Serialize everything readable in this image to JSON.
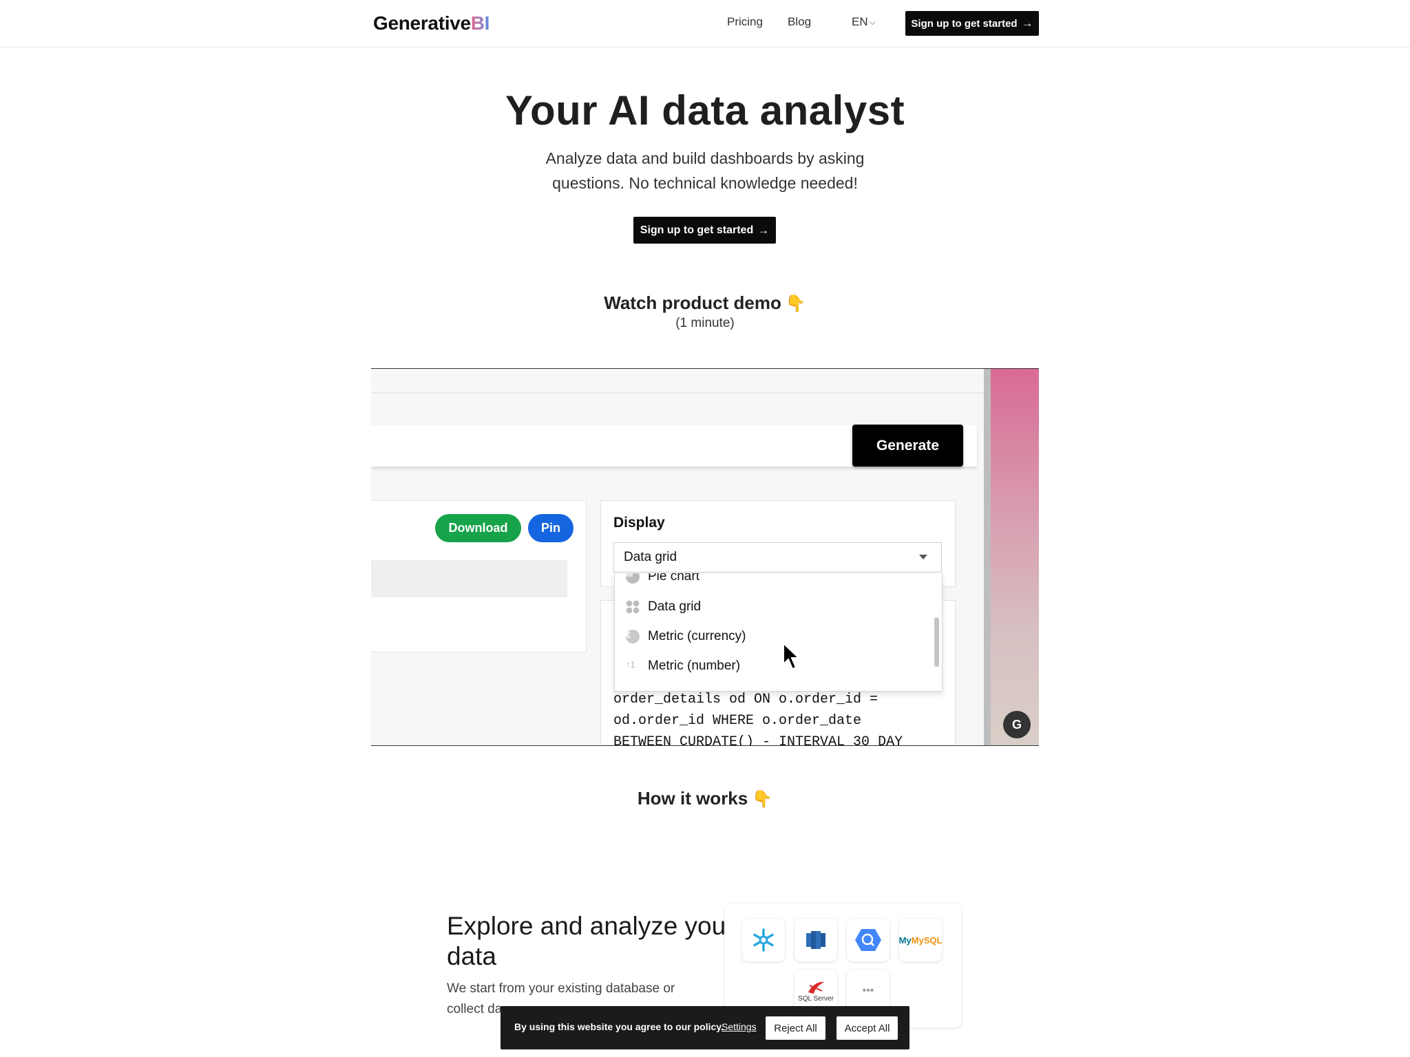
{
  "header": {
    "logo_main": "Generative",
    "logo_accent": "BI",
    "nav": [
      {
        "label": "Pricing"
      },
      {
        "label": "Blog"
      }
    ],
    "language": "EN",
    "cta_label": "Sign up to get started"
  },
  "hero": {
    "title": "Your AI data analyst",
    "subtitle": "Analyze data and build dashboards by asking questions. No technical knowledge needed!",
    "cta_label": "Sign up to get started"
  },
  "demo": {
    "title": "Watch product demo",
    "duration": "(1 minute)",
    "video": {
      "generate_label": "Generate",
      "download_label": "Download",
      "pin_label": "Pin",
      "display_label": "Display",
      "display_value": "Data grid",
      "options": [
        "Pie chart",
        "Data grid",
        "Metric (currency)",
        "Metric (number)"
      ],
      "sql_lines": [
        "order_details od ON o.order_id =",
        "od.order_id WHERE o.order_date",
        "BETWEEN CURDATE() - INTERVAL 30 DAY"
      ],
      "badge": "G"
    }
  },
  "how_it_works": {
    "title": "How it works"
  },
  "explore": {
    "title": "Explore and analyze your data",
    "description": "We start from your existing database or collect da",
    "logos": [
      "snowflake-icon",
      "redshift-icon",
      "bigquery-icon",
      "mysql-icon",
      "sql-server-icon",
      "more-icon"
    ],
    "mysql_label": "MySQL",
    "sqlserver_label": "SQL Server",
    "more_label": "•••"
  },
  "cookie": {
    "text": "By using this website you agree to our policy.",
    "settings_label": "Settings",
    "reject_label": "Reject All",
    "accept_label": "Accept All"
  }
}
